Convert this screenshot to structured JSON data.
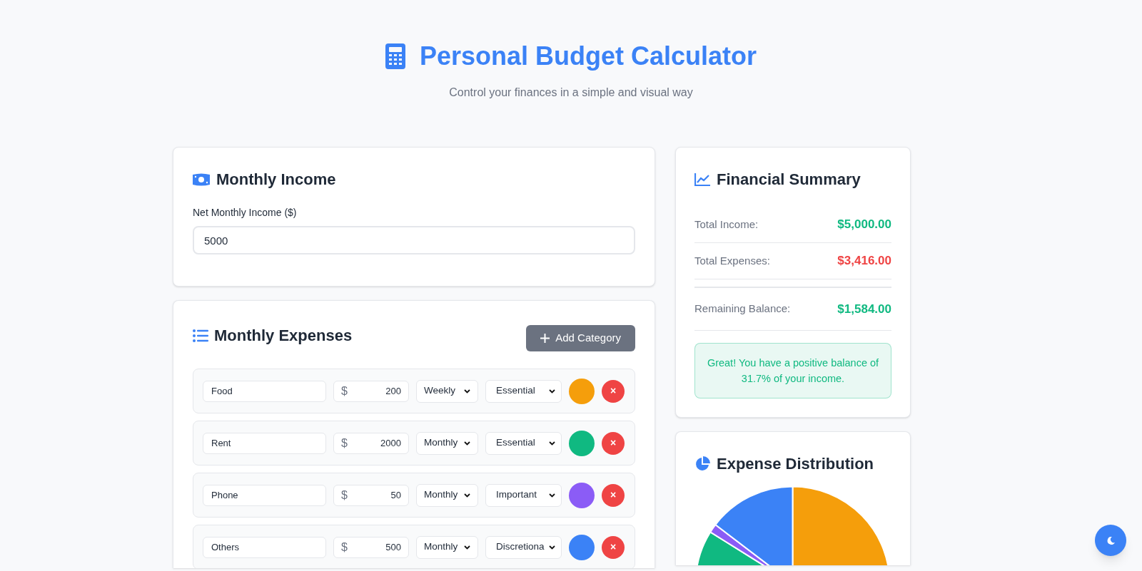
{
  "header": {
    "title": "Personal Budget Calculator",
    "subtitle": "Control your finances in a simple and visual way"
  },
  "income": {
    "title": "Monthly Income",
    "label": "Net Monthly Income ($)",
    "value": "5000"
  },
  "expenses": {
    "title": "Monthly Expenses",
    "add_button": "Add Category",
    "currency": "$",
    "items": [
      {
        "name": "Food",
        "amount": "200",
        "frequency": "Weekly",
        "category": "Essential",
        "color": "#f59e0b",
        "delete": "×"
      },
      {
        "name": "Rent",
        "amount": "2000",
        "frequency": "Monthly",
        "category": "Essential",
        "color": "#10b981",
        "delete": "×"
      },
      {
        "name": "Phone",
        "amount": "50",
        "frequency": "Monthly",
        "category": "Important",
        "color": "#8b5cf6",
        "delete": "×"
      },
      {
        "name": "Others",
        "amount": "500",
        "frequency": "Monthly",
        "category": "Discretiona",
        "color": "#3b82f6",
        "delete": "×"
      }
    ]
  },
  "summary": {
    "title": "Financial Summary",
    "rows": [
      {
        "label": "Total Income:",
        "value": "$5,000.00",
        "color": "#10b981"
      },
      {
        "label": "Total Expenses:",
        "value": "$3,416.00",
        "color": "#ef4444"
      }
    ],
    "balance": {
      "label": "Remaining Balance:",
      "value": "$1,584.00",
      "color": "#10b981"
    },
    "message": {
      "text": "Great! You have a positive balance of 31.7% of your income.",
      "color": "#10b981"
    }
  },
  "distribution": {
    "title": "Expense Distribution"
  }
}
